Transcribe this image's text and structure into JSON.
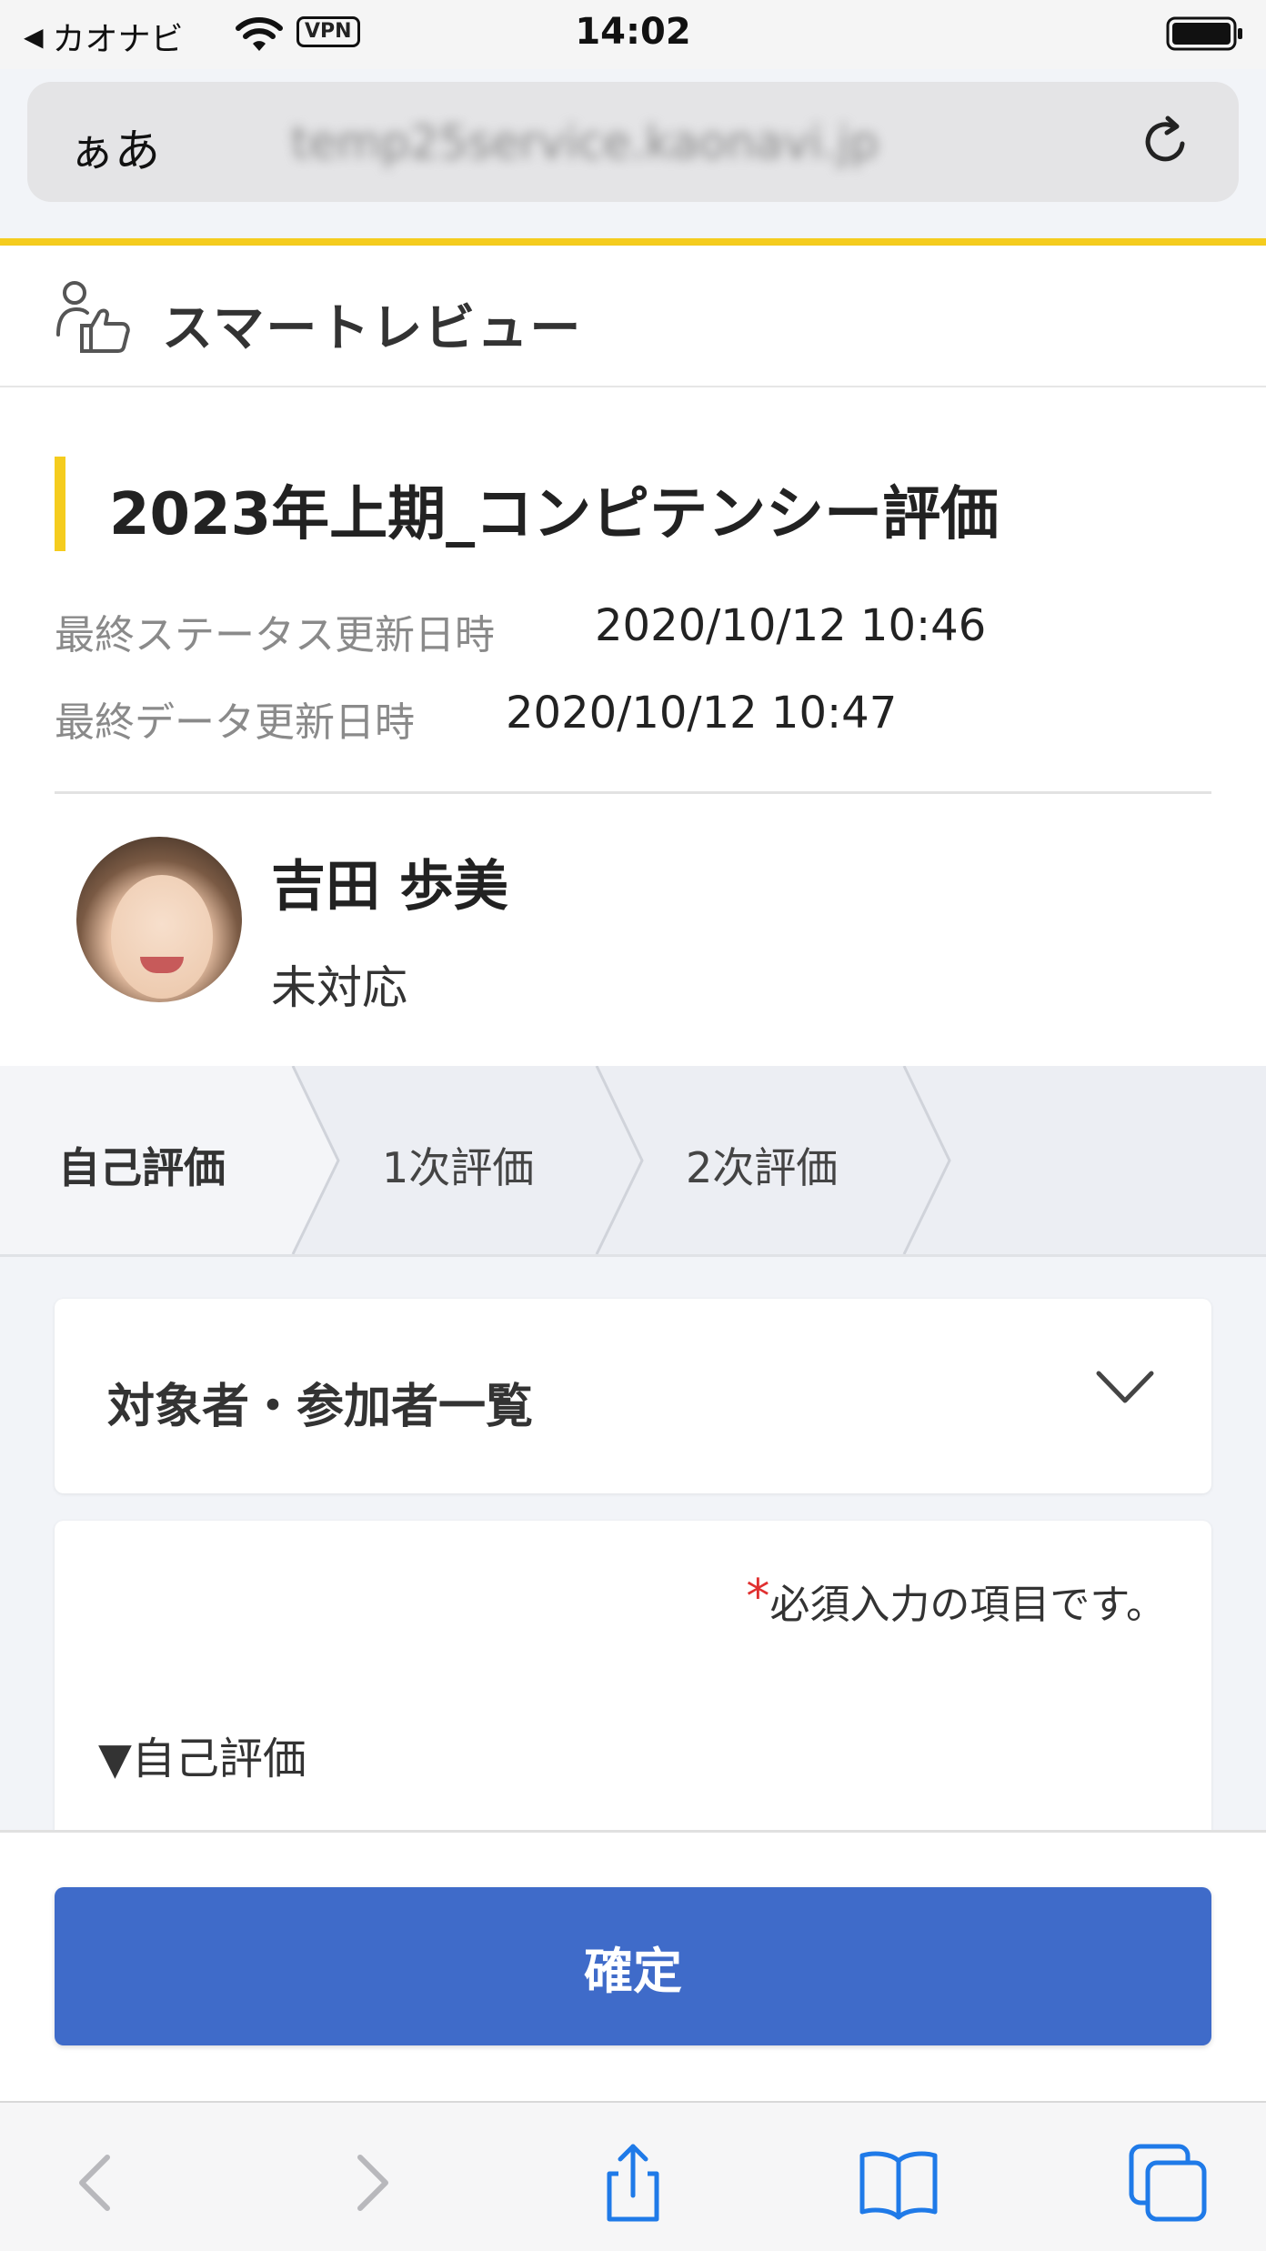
{
  "status_bar": {
    "back_app": "カオナビ",
    "vpn": "VPN",
    "time": "14:02"
  },
  "url_bar": {
    "text_size": "ぁあ",
    "host": "temp25service.kaonavi.jp"
  },
  "app_header": {
    "title": "スマートレビュー"
  },
  "review": {
    "title": "2023年上期_コンピテンシー評価",
    "status_updated_label": "最終ステータス更新日時",
    "status_updated_value": "2020/10/12 10:46",
    "data_updated_label": "最終データ更新日時",
    "data_updated_value": "2020/10/12 10:47"
  },
  "person": {
    "name": "吉田 歩美",
    "status": "未対応"
  },
  "steps": [
    {
      "label": "自己評価",
      "active": true
    },
    {
      "label": "1次評価",
      "active": false
    },
    {
      "label": "2次評価",
      "active": false
    }
  ],
  "accordion": {
    "title": "対象者・参加者一覧"
  },
  "form": {
    "required_mark": "*",
    "required_note": "必須入力の項目です。",
    "section_label": "▼自己評価"
  },
  "confirm_button": {
    "label": "確定"
  },
  "colors": {
    "accent_yellow": "#f5cc1e",
    "primary_blue": "#3f6bc9",
    "safari_blue": "#1f7ae8",
    "required_red": "#e03030"
  },
  "icons": [
    "back-arrow-icon",
    "wifi-icon",
    "battery-icon",
    "reload-icon",
    "user-thumbs-up-icon",
    "chevron-down-icon",
    "chevron-left-icon",
    "chevron-right-icon",
    "share-icon",
    "bookmarks-icon",
    "tabs-icon"
  ]
}
